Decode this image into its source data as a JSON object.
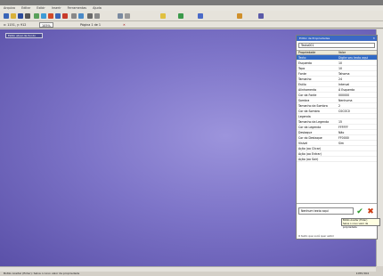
{
  "window": {
    "title": ""
  },
  "menu": [
    "Arquivo",
    "Editar",
    "Exibir",
    "Inserir",
    "Ferramentas",
    "Ajuda"
  ],
  "coordbar": {
    "coords": "x: 1151, y: 912",
    "zoom": "105%",
    "page_info": "Página 1 de 1",
    "close": "✕"
  },
  "canvas_button": "Estilo atual de fundo",
  "panel": {
    "title": "Editor de Propriedades",
    "close": "✕",
    "selector": "Texto001",
    "columns": [
      "Propriedade",
      "Valor"
    ],
    "rows": [
      {
        "prop": "Texto",
        "value": "Digite seu texto aqui",
        "selected": true
      },
      {
        "prop": "Esquerda",
        "value": "10"
      },
      {
        "prop": "Topo",
        "value": "10"
      },
      {
        "prop": "Fonte",
        "value": "Tahoma"
      },
      {
        "prop": "Tamanho",
        "value": "24"
      },
      {
        "prop": "Estilo",
        "value": "Interval"
      },
      {
        "prop": "Alinhamento",
        "value": "À Esquerda"
      },
      {
        "prop": "Cor da Fonte",
        "value": "000000"
      },
      {
        "prop": "Sombra",
        "value": "Nenhuma"
      },
      {
        "prop": "Tamanho da Sombra",
        "value": "2"
      },
      {
        "prop": "Cor da Sombra",
        "value": "C0C0C0"
      },
      {
        "prop": "Legenda",
        "value": ""
      },
      {
        "prop": "Tamanho da Legenda",
        "value": "15"
      },
      {
        "prop": "Cor da Legenda",
        "value": "FFFFFF"
      },
      {
        "prop": "Destaque",
        "value": "Não"
      },
      {
        "prop": "Cor do Destaque",
        "value": "FF0000"
      },
      {
        "prop": "Visível",
        "value": "Sim"
      },
      {
        "prop": "Ação (ao Clicar)",
        "value": ""
      },
      {
        "prop": "Ação (ao Entrar)",
        "value": ""
      },
      {
        "prop": "Ação (ao Sair)",
        "value": ""
      }
    ],
    "edit_value": "Nenhum texto aqui",
    "ok_symbol": "✔",
    "cancel_symbol": "✖",
    "tooltip_title": "Botão Aceitar (Enter)",
    "tooltip_text": "Salva o novo valor da propriedade",
    "hint": "O texto que você quer exibir"
  },
  "status": {
    "left": "Botão Aceitar (Enter): Salva o novo valor da propriedade",
    "right": "1055,564"
  },
  "colors": {
    "canvas": "#7d74c8",
    "panel_title": "#3b69c4",
    "selection": "#316ac5"
  },
  "toolbar_icons": [
    "new-icon",
    "open-icon",
    "save-icon",
    "print-icon",
    "cut-icon",
    "copy-icon",
    "paste-icon",
    "undo-icon",
    "redo-icon",
    "text-icon",
    "image-icon",
    "shape-icon",
    "zoom-icon",
    "grid-icon",
    "align-icon",
    "color-icon",
    "layer-icon",
    "preview-icon",
    "export-icon",
    "help-icon"
  ]
}
